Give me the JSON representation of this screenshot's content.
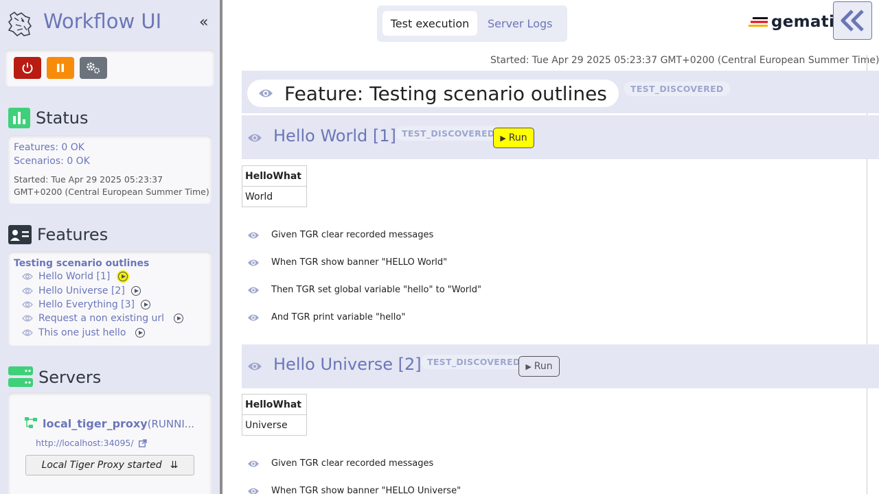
{
  "sidebar": {
    "title": "Workflow UI",
    "status": {
      "heading": "Status",
      "features_line": "Features: 0 OK",
      "scenarios_line": "Scenarios: 0 OK",
      "started": "Started: Tue Apr 29 2025 05:23:37 GMT+0200 (Central European Summer Time)"
    },
    "features": {
      "heading": "Features",
      "group_title": "Testing scenario outlines",
      "items": [
        {
          "label": "Hello World  [1]"
        },
        {
          "label": "Hello Universe  [2]"
        },
        {
          "label": "Hello Everything  [3]"
        },
        {
          "label": "Request a non existing url"
        },
        {
          "label": "This one just hello"
        }
      ]
    },
    "servers": {
      "heading": "Servers",
      "name": "local_tiger_proxy",
      "state": "(RUNNI...",
      "url": "http://localhost:34095/",
      "message": "Local Tiger Proxy started"
    }
  },
  "main": {
    "tabs": [
      {
        "label": "Test execution"
      },
      {
        "label": "Server Logs"
      }
    ],
    "brand": "gematik",
    "started": "Started: Tue Apr 29 2025 05:23:37 GMT+0200 (Central European Summer Time)",
    "feature": {
      "title": "Feature: Testing scenario outlines",
      "status": "TEST_DISCOVERED"
    },
    "scenarios": [
      {
        "title": "Hello World [1]",
        "status": "TEST_DISCOVERED",
        "run_label": "Run",
        "table_header": "HelloWhat",
        "table_value": "World",
        "steps": [
          "Given TGR clear recorded messages",
          "When TGR show banner \"HELLO World\"",
          "Then TGR set global variable \"hello\" to \"World\"",
          "And TGR print variable \"hello\""
        ]
      },
      {
        "title": "Hello Universe [2]",
        "status": "TEST_DISCOVERED",
        "run_label": "Run",
        "table_header": "HelloWhat",
        "table_value": "Universe",
        "steps": [
          "Given TGR clear recorded messages",
          "When TGR show banner \"HELLO Universe\""
        ]
      }
    ]
  },
  "colors": {
    "accent": "#6b76b8",
    "sidebar_bg": "#e4e6f3",
    "quit_button": "#b81c12",
    "pause_button": "#f78c0a",
    "config_button": "#6c737d",
    "status_green": "#3fd07a",
    "run_highlight": "#ffff00"
  }
}
